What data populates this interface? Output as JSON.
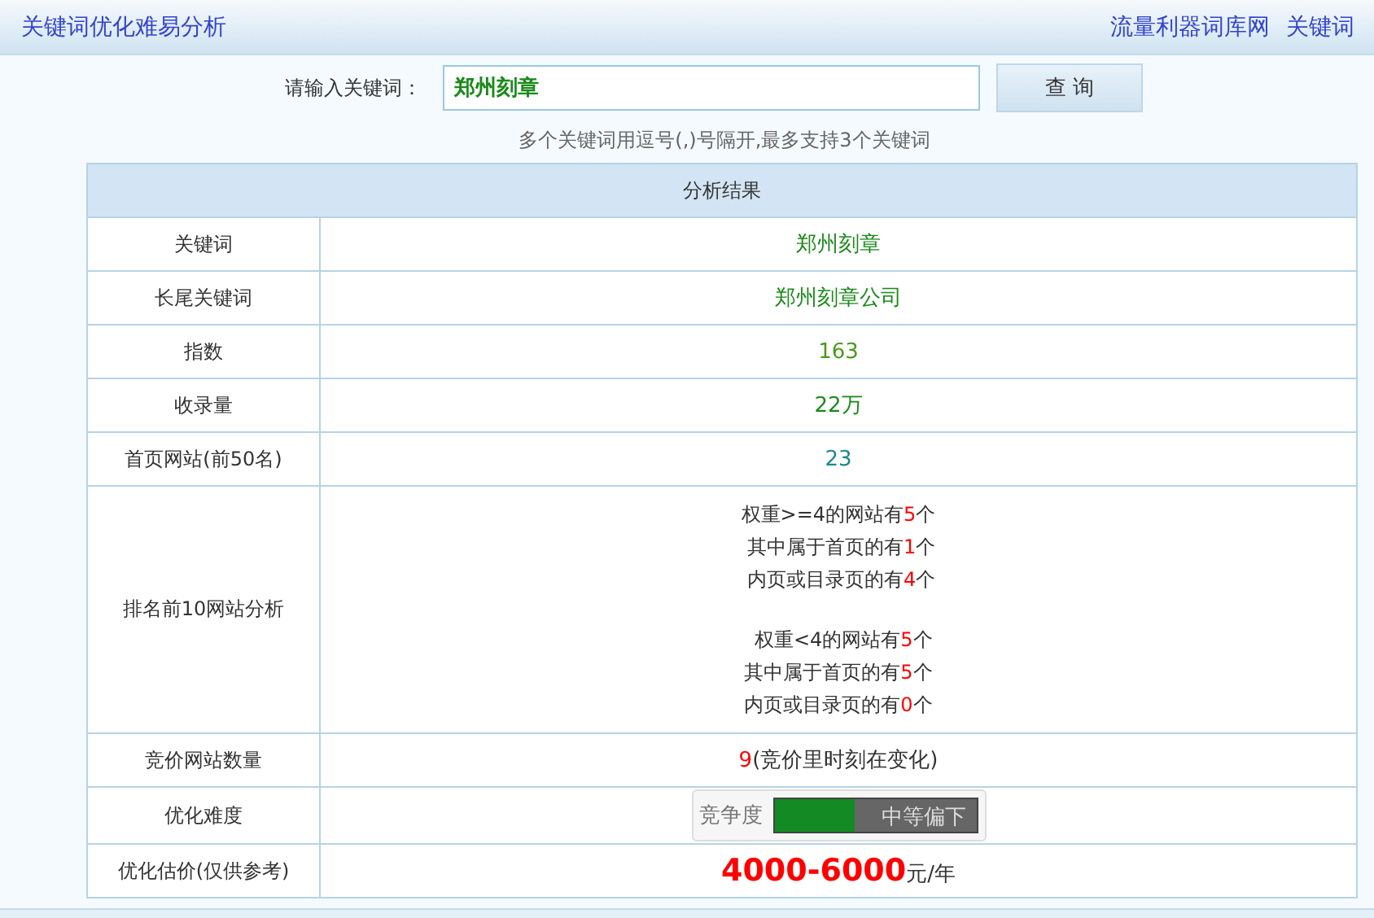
{
  "header": {
    "title": "关键词优化难易分析",
    "links": [
      "流量利器词库网",
      "关键词"
    ]
  },
  "search": {
    "label": "请输入关键词：",
    "value": "郑州刻章",
    "button": "查 询",
    "hint": "多个关键词用逗号(,)号隔开,最多支持3个关键词"
  },
  "table": {
    "title": "分析结果",
    "rows": [
      {
        "label": "关键词",
        "kind": "text",
        "color": "#1a8a1a",
        "value": "郑州刻章"
      },
      {
        "label": "长尾关键词",
        "kind": "text",
        "color": "#1a8a1a",
        "value": "郑州刻章公司"
      },
      {
        "label": "指数",
        "kind": "text",
        "color": "#4a9a1a",
        "value": "163"
      },
      {
        "label": "收录量",
        "kind": "text",
        "color": "#1a8a1a",
        "value": "22万"
      },
      {
        "label": "首页网站(前50名)",
        "kind": "text",
        "color": "#1a8a8a",
        "value": "23"
      },
      {
        "label": "排名前10网站分析",
        "kind": "lines",
        "groups": [
          [
            [
              {
                "text": "权重>=4的网站有"
              },
              {
                "text": "5",
                "kind": "count"
              },
              {
                "text": "个"
              }
            ],
            [
              {
                "text": "其中属于首页的有"
              },
              {
                "text": "1",
                "kind": "count"
              },
              {
                "text": "个"
              }
            ],
            [
              {
                "text": "内页或目录页的有"
              },
              {
                "text": "4",
                "kind": "count"
              },
              {
                "text": "个"
              }
            ]
          ],
          [
            [
              {
                "text": "权重<4的网站有"
              },
              {
                "text": "5",
                "kind": "count"
              },
              {
                "text": "个"
              }
            ],
            [
              {
                "text": "其中属于首页的有"
              },
              {
                "text": "5",
                "kind": "count"
              },
              {
                "text": "个"
              }
            ],
            [
              {
                "text": "内页或目录页的有"
              },
              {
                "text": "0",
                "kind": "count"
              },
              {
                "text": "个"
              }
            ]
          ]
        ]
      },
      {
        "label": "竞价网站数量",
        "kind": "bid",
        "count": "9",
        "note": "(竞价里时刻在变化)"
      },
      {
        "label": "优化难度",
        "kind": "meter",
        "meter_label": "竞争度",
        "level": 0.4,
        "reading": "中等偏下"
      },
      {
        "label": "优化估价(仅供参考)",
        "kind": "price",
        "price": "4000-6000",
        "unit": "元/年"
      }
    ]
  }
}
